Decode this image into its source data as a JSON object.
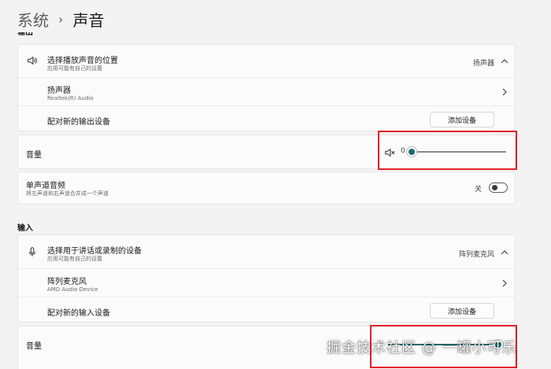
{
  "breadcrumb": {
    "parent": "系统",
    "separator": "›",
    "current": "声音"
  },
  "output": {
    "section_label": "输出",
    "device_select": {
      "title": "选择播放声音的位置",
      "subtitle": "应用可能有自己的设置",
      "value": "扬声器"
    },
    "device_item": {
      "title": "扬声器",
      "subtitle": "Realtek(R) Audio"
    },
    "pair": {
      "title": "配对新的输出设备",
      "button": "添加设备"
    },
    "volume": {
      "label": "音量",
      "value_text": "0",
      "level": 0
    },
    "mono": {
      "title": "单声道音频",
      "subtitle": "将左声道和右声道合并成一个声道",
      "state": "关"
    }
  },
  "input": {
    "section_label": "输入",
    "device_select": {
      "title": "选择用于讲话或录制的设备",
      "subtitle": "应用可能有自己的设置",
      "value": "阵列麦克风"
    },
    "device_item": {
      "title": "阵列麦克风",
      "subtitle": "AMD Audio Device"
    },
    "pair": {
      "title": "配对新的输入设备",
      "button": "添加设备"
    },
    "volume": {
      "label": "音量",
      "level": 1.0
    }
  },
  "watermark": "掘金技术社区 @ 一罐小可乐",
  "colors": {
    "accent": "#1a6b6b",
    "highlight": "#e0202a",
    "background": "#f3f3f3",
    "card": "#fbfbfb"
  }
}
